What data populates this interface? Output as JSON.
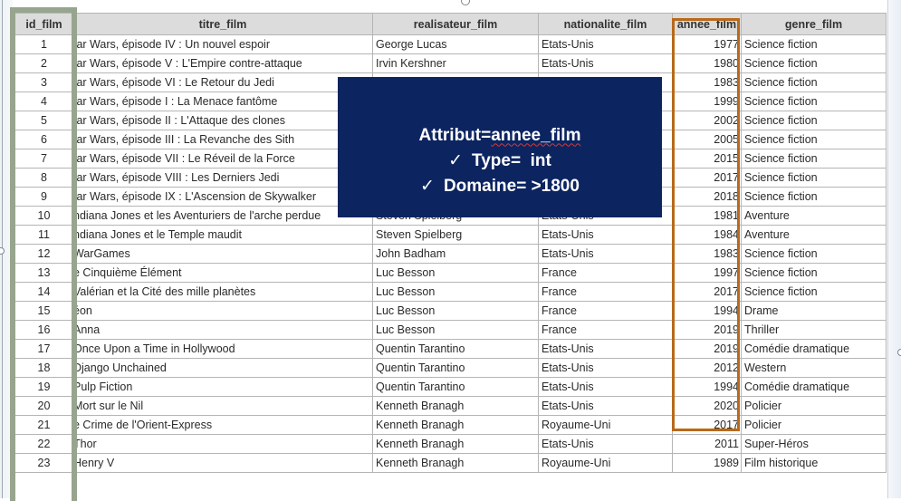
{
  "table": {
    "headers": [
      "id_film",
      "titre_film",
      "realisateur_film",
      "nationalite_film",
      "annee_film",
      "genre_film"
    ],
    "rows": [
      [
        "1",
        "tar Wars, épisode IV : Un nouvel espoir",
        "George Lucas",
        "Etats-Unis",
        "1977",
        "Science fiction"
      ],
      [
        "2",
        "tar Wars, épisode V : L'Empire contre-attaque",
        "Irvin Kershner",
        "Etats-Unis",
        "1980",
        "Science fiction"
      ],
      [
        "3",
        "tar Wars, épisode VI : Le Retour du Jedi",
        "",
        "",
        "1983",
        "Science fiction"
      ],
      [
        "4",
        "tar Wars, épisode I : La Menace fantôme",
        "",
        "",
        "1999",
        "Science fiction"
      ],
      [
        "5",
        "tar Wars, épisode II : L'Attaque des clones",
        "",
        "",
        "2002",
        "Science fiction"
      ],
      [
        "6",
        "tar Wars, épisode III : La Revanche des Sith",
        "",
        "",
        "2005",
        "Science fiction"
      ],
      [
        "7",
        "tar Wars, épisode VII : Le Réveil de la Force",
        "",
        "",
        "2015",
        "Science fiction"
      ],
      [
        "8",
        "tar Wars, épisode VIII : Les Derniers Jedi",
        "",
        "",
        "2017",
        "Science fiction"
      ],
      [
        "9",
        "tar Wars, épisode IX : L'Ascension de Skywalker",
        "",
        "",
        "2018",
        "Science fiction"
      ],
      [
        "10",
        "ndiana Jones et les Aventuriers de l'arche perdue",
        "Steven Spielberg",
        "Etats-Unis",
        "1981",
        "Aventure"
      ],
      [
        "11",
        "ndiana Jones et le Temple maudit",
        "Steven Spielberg",
        "Etats-Unis",
        "1984",
        "Aventure"
      ],
      [
        "12",
        "WarGames",
        "John Badham",
        "Etats-Unis",
        "1983",
        "Science fiction"
      ],
      [
        "13",
        "e Cinquième Élément",
        "Luc Besson",
        "France",
        "1997",
        "Science fiction"
      ],
      [
        "14",
        "Valérian et la Cité des mille planètes",
        "Luc Besson",
        "France",
        "2017",
        "Science fiction"
      ],
      [
        "15",
        "éon",
        "Luc Besson",
        "France",
        "1994",
        "Drame"
      ],
      [
        "16",
        "Anna",
        "Luc Besson",
        "France",
        "2019",
        "Thriller"
      ],
      [
        "17",
        "Once Upon a Time in Hollywood",
        "Quentin Tarantino",
        "Etats-Unis",
        "2019",
        "Comédie dramatique"
      ],
      [
        "18",
        "Django Unchained",
        "Quentin Tarantino",
        "Etats-Unis",
        "2012",
        "Western"
      ],
      [
        "19",
        "Pulp Fiction",
        "Quentin Tarantino",
        "Etats-Unis",
        "1994",
        "Comédie dramatique"
      ],
      [
        "20",
        "Mort sur le Nil",
        "Kenneth Branagh",
        "Etats-Unis",
        "2020",
        "Policier"
      ],
      [
        "21",
        "e Crime de l'Orient-Express",
        "Kenneth Branagh",
        "Royaume-Uni",
        "2017",
        "Policier"
      ],
      [
        "22",
        "Thor",
        "Kenneth Branagh",
        "Etats-Unis",
        "2011",
        "Super-Héros"
      ],
      [
        "23",
        "Henry V",
        "Kenneth Branagh",
        "Royaume-Uni",
        "1989",
        "Film historique"
      ]
    ]
  },
  "info_box": {
    "attribute_label": "Attribut=",
    "attribute_value": "annee_film",
    "type_label": "Type=",
    "type_value": "int",
    "domain_label": "Domaine=",
    "domain_value": ">1800",
    "check_icon": "✓"
  },
  "colors": {
    "info_box_bg": "#0c2460",
    "id_column_frame": "#98a58e",
    "year_column_frame": "#b8691a",
    "header_bg": "#dcdcdc"
  }
}
